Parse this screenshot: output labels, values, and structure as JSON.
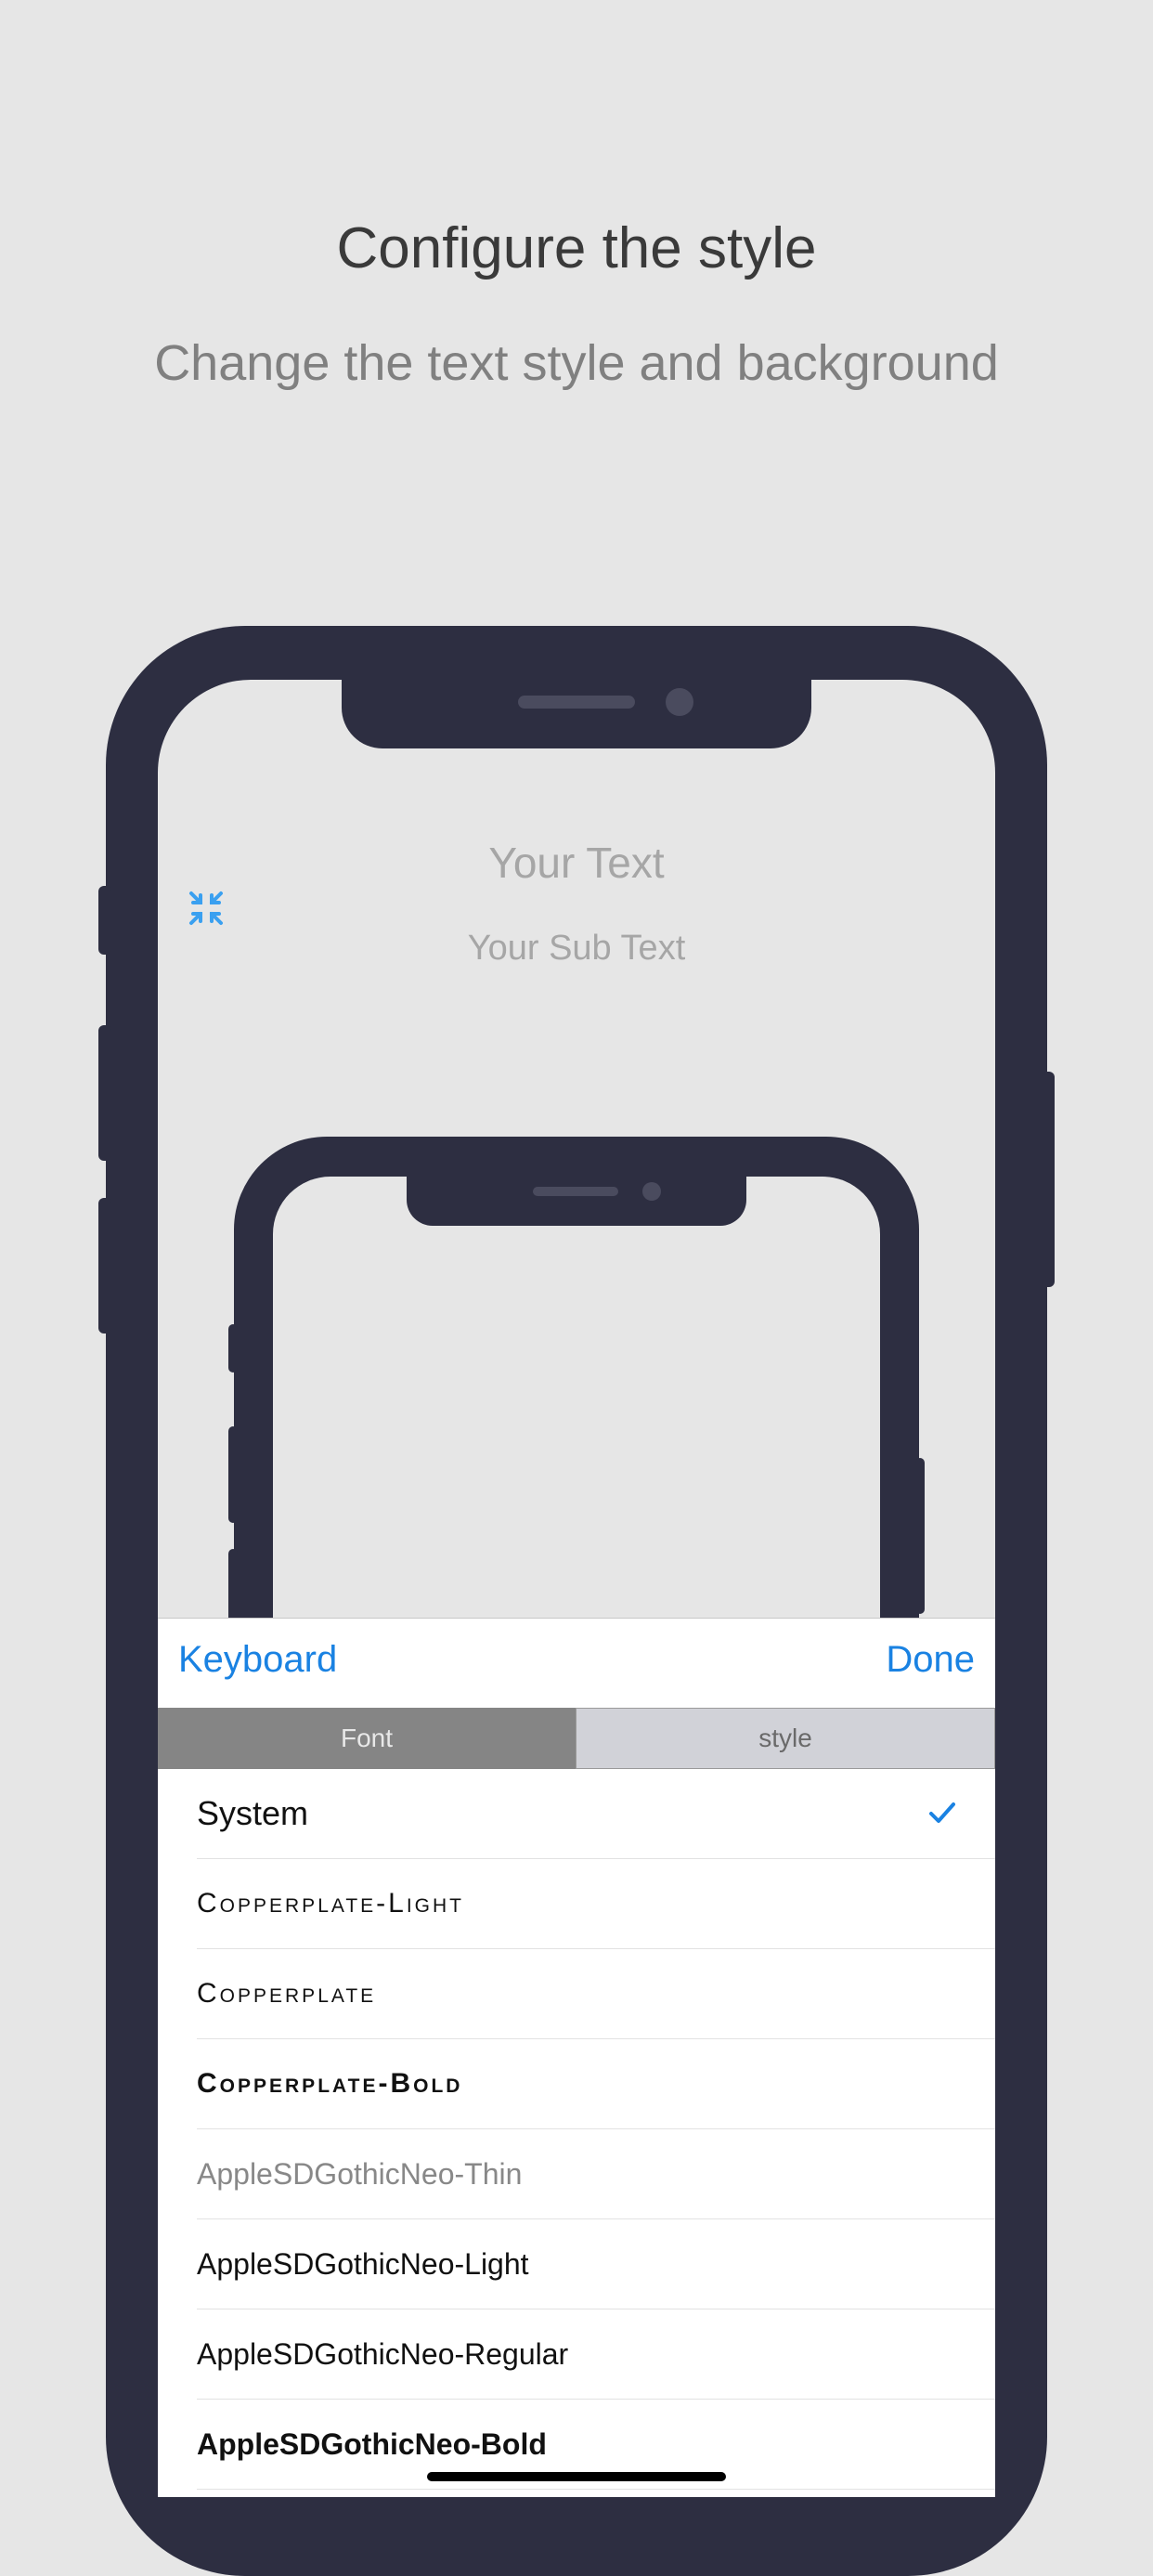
{
  "header": {
    "title": "Configure the style",
    "subtitle": "Change the text style and background"
  },
  "preview": {
    "title": "Your Text",
    "subtitle": "Your Sub Text",
    "shrink_icon": "shrink-arrows-icon"
  },
  "toolbar": {
    "keyboard_label": "Keyboard",
    "done_label": "Done"
  },
  "segments": {
    "font_label": "Font",
    "style_label": "style",
    "selected": "Font"
  },
  "fonts": [
    {
      "name": "System",
      "selected": true
    },
    {
      "name": "Copperplate-Light",
      "selected": false
    },
    {
      "name": "Copperplate",
      "selected": false
    },
    {
      "name": "Copperplate-Bold",
      "selected": false
    },
    {
      "name": "AppleSDGothicNeo-Thin",
      "selected": false
    },
    {
      "name": "AppleSDGothicNeo-Light",
      "selected": false
    },
    {
      "name": "AppleSDGothicNeo-Regular",
      "selected": false
    },
    {
      "name": "AppleSDGothicNeo-Bold",
      "selected": false
    }
  ],
  "colors": {
    "accent": "#1a82e2",
    "phone_frame": "#2d2e41",
    "background": "#e6e6e6"
  }
}
